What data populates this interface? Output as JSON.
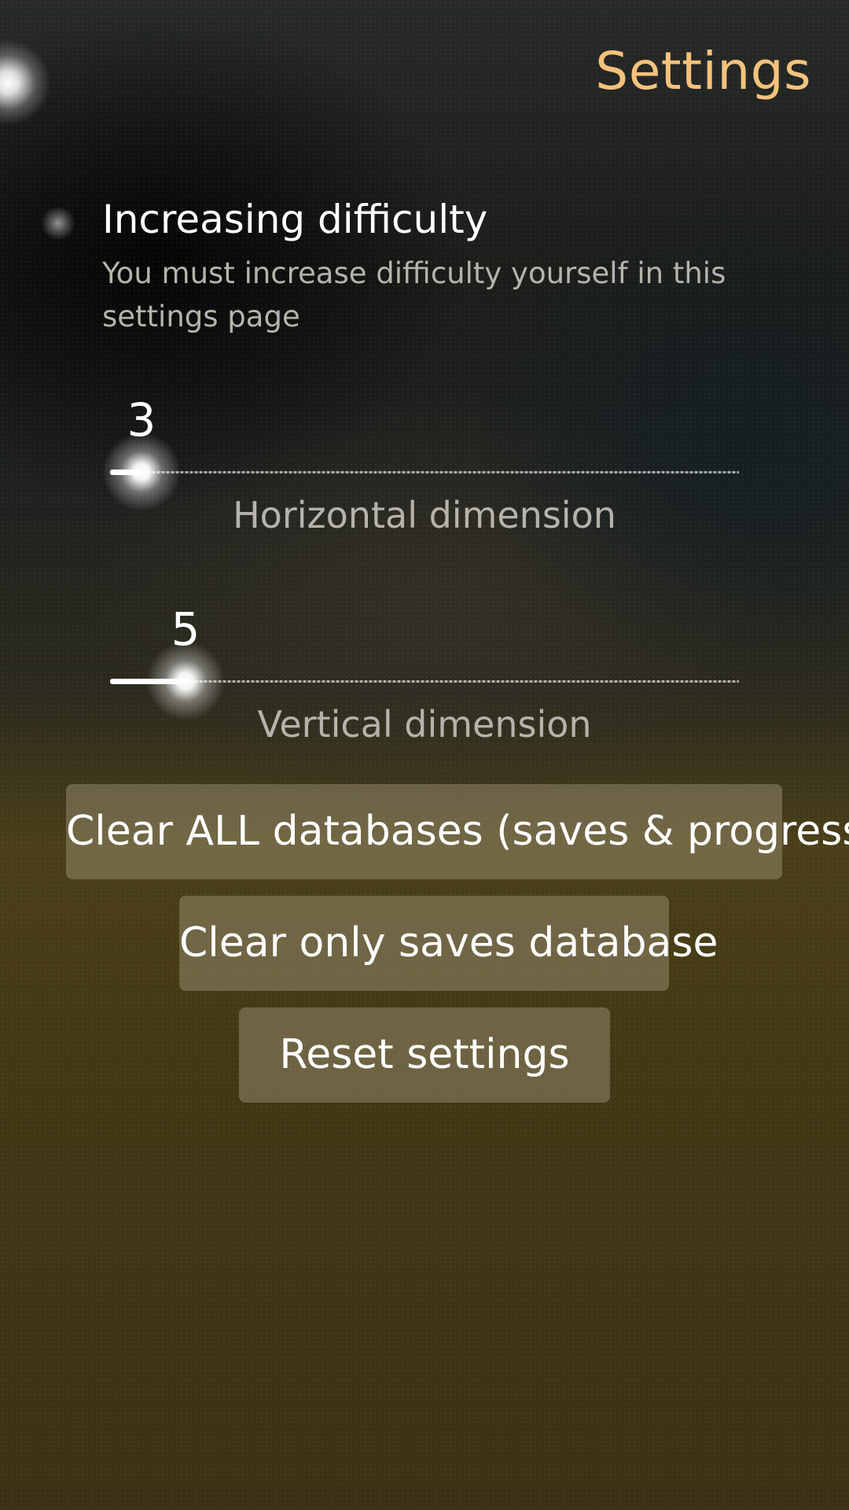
{
  "page": {
    "title": "Settings"
  },
  "difficulty_switch": {
    "label": "Increasing difficulty",
    "description": "You must increase difficulty yourself in this settings page",
    "checked": false
  },
  "sliders": [
    {
      "label": "Horizontal dimension",
      "value": "3",
      "fraction": 0.05
    },
    {
      "label": "Vertical dimension",
      "value": "5",
      "fraction": 0.12
    }
  ],
  "buttons": {
    "clear_all": "Clear ALL databases (saves & progress)",
    "clear_saves": "Clear only saves database",
    "reset": "Reset settings"
  },
  "colors": {
    "title": "#f5c27c",
    "secondary_text": "#b5b3ab",
    "button_bg": "rgba(170,160,130,0.42)"
  }
}
